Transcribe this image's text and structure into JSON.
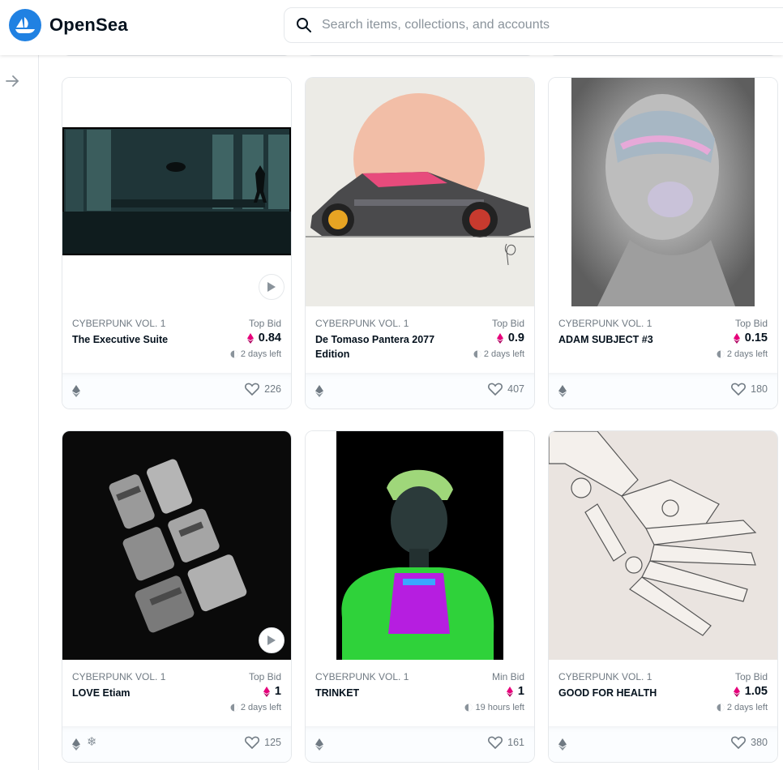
{
  "header": {
    "brand": "OpenSea",
    "search_placeholder": "Search items, collections, and accounts"
  },
  "colors": {
    "brand_blue": "#2081e2",
    "eth_pink": "#e6007a",
    "text_dark": "#04111d",
    "text_muted": "#707a83"
  },
  "cards": [
    {
      "collection": "CYBERPUNK VOL. 1",
      "name": "The Executive Suite",
      "bid_label": "Top Bid",
      "price": "0.84",
      "time_left": "2 days left",
      "likes": "226",
      "has_play": true,
      "icon": "eth-icon"
    },
    {
      "collection": "CYBERPUNK VOL. 1",
      "name": "De Tomaso Pantera 2077 Edition",
      "bid_label": "Top Bid",
      "price": "0.9",
      "time_left": "2 days left",
      "likes": "407",
      "has_play": false,
      "icon": "eth-icon"
    },
    {
      "collection": "CYBERPUNK VOL. 1",
      "name": "ADAM SUBJECT #3",
      "bid_label": "Top Bid",
      "price": "0.15",
      "time_left": "2 days left",
      "likes": "180",
      "has_play": false,
      "icon": "eth-icon"
    },
    {
      "collection": "CYBERPUNK VOL. 1",
      "name": "LOVE Etiam",
      "bid_label": "Top Bid",
      "price": "1",
      "time_left": "2 days left",
      "likes": "125",
      "has_play": true,
      "icon": "eth-icon",
      "extra_icon": "snowflake-icon"
    },
    {
      "collection": "CYBERPUNK VOL. 1",
      "name": "TRINKET",
      "bid_label": "Min Bid",
      "price": "1",
      "time_left": "19 hours left",
      "likes": "161",
      "has_play": false,
      "icon": "eth-icon"
    },
    {
      "collection": "CYBERPUNK VOL. 1",
      "name": "GOOD FOR HEALTH",
      "bid_label": "Top Bid",
      "price": "1.05",
      "time_left": "2 days left",
      "likes": "380",
      "has_play": false,
      "icon": "eth-icon"
    }
  ],
  "snowflake_glyph": "❄"
}
